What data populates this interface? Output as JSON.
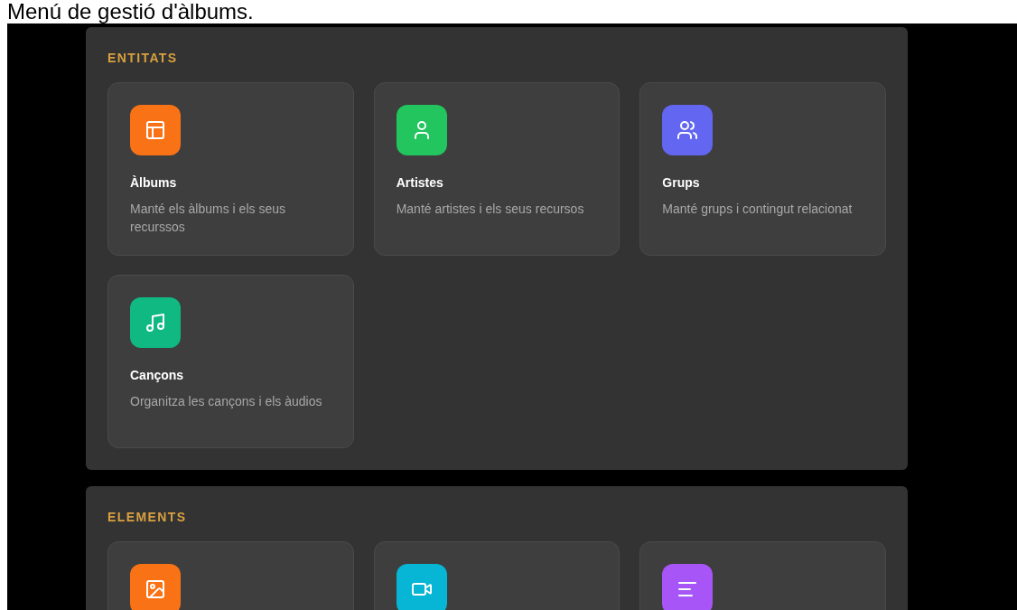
{
  "page_title": "Menú de gestió d'àlbums.",
  "sections": [
    {
      "heading": "ENTITATS",
      "cards": [
        {
          "kind": "album",
          "color": "#f97316",
          "title": "Àlbums",
          "description": "Manté els àlbums i els seus recurssos"
        },
        {
          "kind": "artist",
          "color": "#22c55e",
          "title": "Artistes",
          "description": "Manté artistes i els seus recursos"
        },
        {
          "kind": "group",
          "color": "#6366f1",
          "title": "Grups",
          "description": "Manté grups i contingut relacionat"
        },
        {
          "kind": "song",
          "color": "#10b981",
          "title": "Cançons",
          "description": "Organitza les cançons i els àudios"
        }
      ]
    },
    {
      "heading": "ELEMENTS",
      "cards": [
        {
          "kind": "image",
          "color": "#f97316"
        },
        {
          "kind": "video",
          "color": "#06b6d4"
        },
        {
          "kind": "text",
          "color": "#a855f7"
        }
      ]
    }
  ]
}
